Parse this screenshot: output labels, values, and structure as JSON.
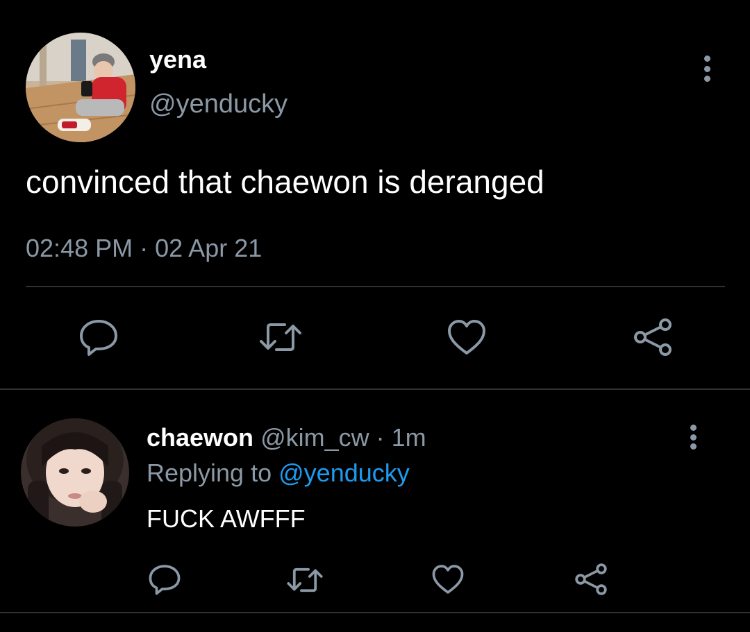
{
  "tweet": {
    "display_name": "yena",
    "handle": "@yenducky",
    "text": "convinced that chaewon is deranged",
    "time": "02:48 PM",
    "separator": "·",
    "date": "02 Apr 21",
    "actions": [
      "reply-icon",
      "retweet-icon",
      "like-icon",
      "share-icon"
    ]
  },
  "reply": {
    "display_name": "chaewon",
    "handle": "@kim_cw",
    "separator": "·",
    "time_ago": "1m",
    "replying_prefix": "Replying to",
    "replying_to": "@yenducky",
    "text": "FUCK AWFFF",
    "actions": [
      "reply-icon",
      "retweet-icon",
      "like-icon",
      "share-icon"
    ]
  },
  "colors": {
    "background": "#000000",
    "text": "#ffffff",
    "muted": "#8b98a5",
    "link": "#1d9bf0",
    "divider": "#2f3336"
  }
}
